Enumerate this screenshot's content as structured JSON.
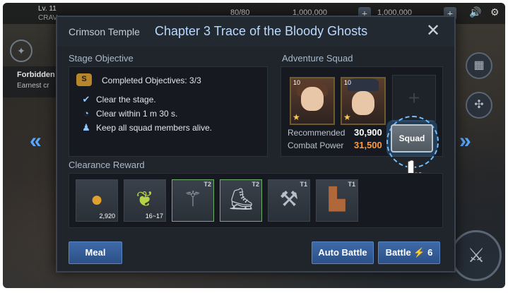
{
  "hud": {
    "level": "Lv. 11",
    "player": "CRAV",
    "stamina": "80/80",
    "currency1": "1,000,000",
    "currency2": "1,000,000"
  },
  "left_panel": {
    "title": "Forbidden",
    "subtitle": "Earnest cr"
  },
  "dialog": {
    "category": "Crimson Temple",
    "title": "Chapter 3 Trace of the Bloody Ghosts",
    "close": "✕",
    "objective_section": "Stage Objective",
    "objectives_header": "Completed Objectives: 3/3",
    "objectives": [
      {
        "text": "Clear the stage.",
        "icon": "check-icon"
      },
      {
        "text": "Clear within 1 m 30 s.",
        "icon": "clock-icon"
      },
      {
        "text": "Keep all squad members alive.",
        "icon": "squad-icon"
      }
    ],
    "squad_section": "Adventure Squad",
    "heroes": [
      {
        "level": "10",
        "name_icon": "hero-knight"
      },
      {
        "level": "10",
        "name_icon": "hero-witch"
      }
    ],
    "empty_slot": "+",
    "recommended_label": "Recommended",
    "combat_power_label": "Combat Power",
    "recommended_value": "30,900",
    "combat_power_value": "31,500",
    "squad_button": "Squad",
    "reward_section": "Clearance Reward",
    "rewards": [
      {
        "icon": "gold-coin-icon",
        "count": "2,920",
        "tier": ""
      },
      {
        "icon": "herb-icon",
        "count": "16~17",
        "tier": ""
      },
      {
        "icon": "staff-icon",
        "count": "",
        "tier": "T2"
      },
      {
        "icon": "boots-icon",
        "count": "",
        "tier": "T2"
      },
      {
        "icon": "axe-icon",
        "count": "",
        "tier": "T1"
      },
      {
        "icon": "leather-boots-icon",
        "count": "",
        "tier": "T1"
      }
    ],
    "meal_button": "Meal",
    "auto_battle_button": "Auto Battle",
    "battle_button": "Battle",
    "battle_cost": "6"
  },
  "colors": {
    "title": "#b9d9ff",
    "accent_blue": "#5aa7ff",
    "combat_power": "#ff9a3a",
    "button_blue": "#3e6aa8"
  }
}
